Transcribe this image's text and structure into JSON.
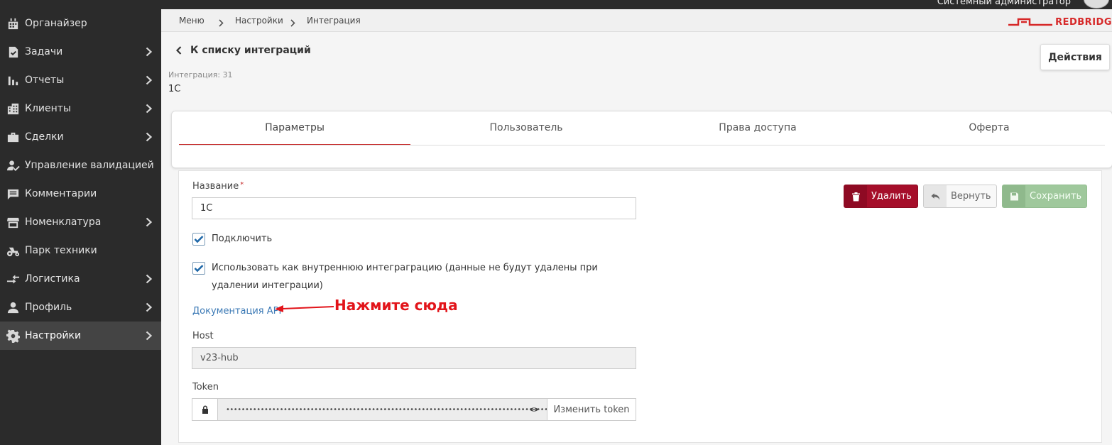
{
  "topbar": {
    "user_role": "Системный администратор"
  },
  "sidebar": {
    "items": [
      {
        "label": "Органайзер",
        "icon": "calendar-icon",
        "has_chevron": false
      },
      {
        "label": "Задачи",
        "icon": "task-check-icon",
        "has_chevron": true
      },
      {
        "label": "Отчеты",
        "icon": "bar-chart-icon",
        "has_chevron": true
      },
      {
        "label": "Клиенты",
        "icon": "building-icon",
        "has_chevron": true
      },
      {
        "label": "Сделки",
        "icon": "briefcase-icon",
        "has_chevron": true
      },
      {
        "label": "Управление валидацией",
        "icon": "user-check-icon",
        "has_chevron": false
      },
      {
        "label": "Комментарии",
        "icon": "comment-icon",
        "has_chevron": false
      },
      {
        "label": "Номенклатура",
        "icon": "store-icon",
        "has_chevron": true
      },
      {
        "label": "Парк техники",
        "icon": "tractor-icon",
        "has_chevron": false
      },
      {
        "label": "Логистика",
        "icon": "transfer-arrows-icon",
        "has_chevron": true
      },
      {
        "label": "Профиль",
        "icon": "person-icon",
        "has_chevron": true
      },
      {
        "label": "Настройки",
        "icon": "gear-icon",
        "has_chevron": true,
        "active": true
      }
    ]
  },
  "breadcrumb": {
    "items": [
      "Меню",
      "Настройки",
      "Интеграция"
    ]
  },
  "logo": {
    "text": "REDBRIDG",
    "color": "#d62828"
  },
  "header": {
    "back_label": "К списку интеграций",
    "integration_meta": "Интеграция: 31",
    "integration_name": "1С",
    "actions_label": "Действия"
  },
  "tabs": [
    {
      "label": "Параметры",
      "active": true
    },
    {
      "label": "Пользователь"
    },
    {
      "label": "Права доступа"
    },
    {
      "label": "Оферта"
    }
  ],
  "form": {
    "name_label": "Название",
    "required_mark": "*",
    "name_value": "1С",
    "connect_label": "Подключить",
    "connect_checked": true,
    "internal_label": "Использовать как внутреннюю интеграграцию (данные не будут удалены при удалении интеграции)",
    "internal_checked": true,
    "docs_link": "Документация API",
    "annotation": "Нажмите сюда",
    "host_label": "Host",
    "host_value": "v23-hub",
    "token_label": "Token",
    "token_masked": "••••••••••••••••••••••••••••••••••••••••••••••••••••••••••••••••••••••••••••••••••••••••••••••",
    "change_token_label": "Изменить token"
  },
  "buttons": {
    "delete_label": "Удалить",
    "revert_label": "Вернуть",
    "save_label": "Сохранить"
  },
  "colors": {
    "accent_red": "#c62828",
    "delete_bg": "#a50e2a",
    "save_bg": "#9fc89c",
    "link": "#3b79b5",
    "sidebar_bg": "#2b2b2b",
    "annotation": "#e2141a"
  }
}
